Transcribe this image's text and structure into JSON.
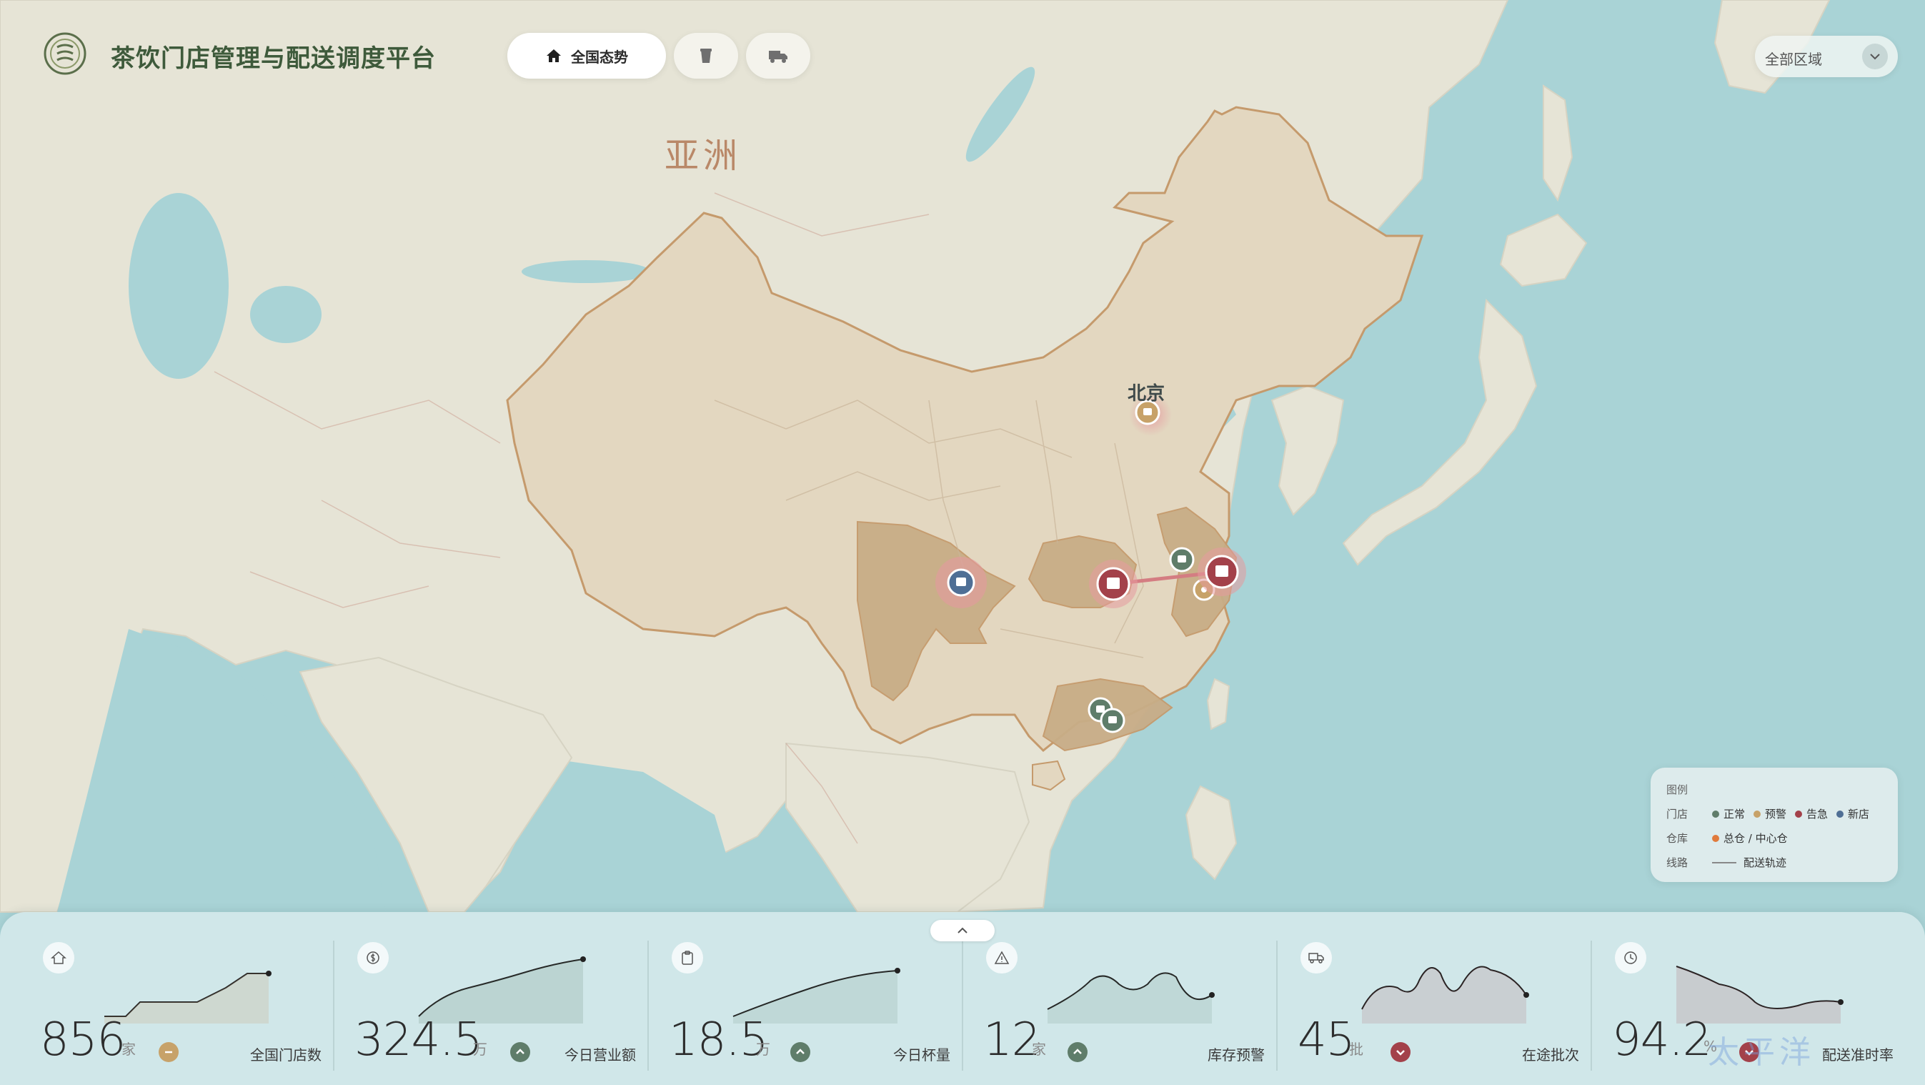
{
  "app": {
    "title": "茶饮门店管理与配送调度平台"
  },
  "nav": [
    {
      "label": "全国态势",
      "icon": "home-icon",
      "active": true
    },
    {
      "label": "",
      "icon": "cup-icon",
      "active": false
    },
    {
      "label": "",
      "icon": "truck-icon",
      "active": false
    }
  ],
  "region_select": {
    "value": "全部区域"
  },
  "map": {
    "continent_label": "亚洲",
    "ocean_label": "太平洋",
    "city_label": "北京",
    "colors": {
      "ocean": "#a9d3d6",
      "land": "#e6e4d6",
      "china": "#e3d7c0",
      "highlight": "#c8ad87",
      "border": "#c59a6c",
      "normal": "#5f7d6a",
      "warning": "#c7a269",
      "alert": "#a3414a",
      "new": "#4f6f95"
    }
  },
  "legend": {
    "title": "图例",
    "store_label": "门店",
    "store_items": [
      {
        "label": "正常",
        "color": "#5f7d6a"
      },
      {
        "label": "预警",
        "color": "#c7a269"
      },
      {
        "label": "告急",
        "color": "#a3414a"
      },
      {
        "label": "新店",
        "color": "#4f6f95"
      }
    ],
    "warehouse_label": "仓库",
    "warehouse_item": {
      "label": "总仓 / 中心仓",
      "color": "#e07a3c"
    },
    "route_label": "线路",
    "route_item": {
      "label": "配送轨迹"
    }
  },
  "kpis": [
    {
      "icon": "home-icon",
      "value": "856",
      "unit": "家",
      "label": "全国门店数",
      "trend": "flat",
      "trend_color": "#c7a269"
    },
    {
      "icon": "dollar-icon",
      "value": "324.5",
      "unit": "万",
      "label": "今日营业额",
      "trend": "up",
      "trend_color": "#5f7d6a"
    },
    {
      "icon": "clipboard-icon",
      "value": "18.5",
      "unit": "万",
      "label": "今日杯量",
      "trend": "up",
      "trend_color": "#5f7d6a"
    },
    {
      "icon": "warning-icon",
      "value": "12",
      "unit": "家",
      "label": "库存预警",
      "trend": "up",
      "trend_color": "#5f7d6a"
    },
    {
      "icon": "truck-icon",
      "value": "45",
      "unit": "批",
      "label": "在途批次",
      "trend": "down",
      "trend_color": "#a3414a"
    },
    {
      "icon": "clock-icon",
      "value": "94.2",
      "unit": "%",
      "label": "配送准时率",
      "trend": "down",
      "trend_color": "#a3414a"
    }
  ]
}
